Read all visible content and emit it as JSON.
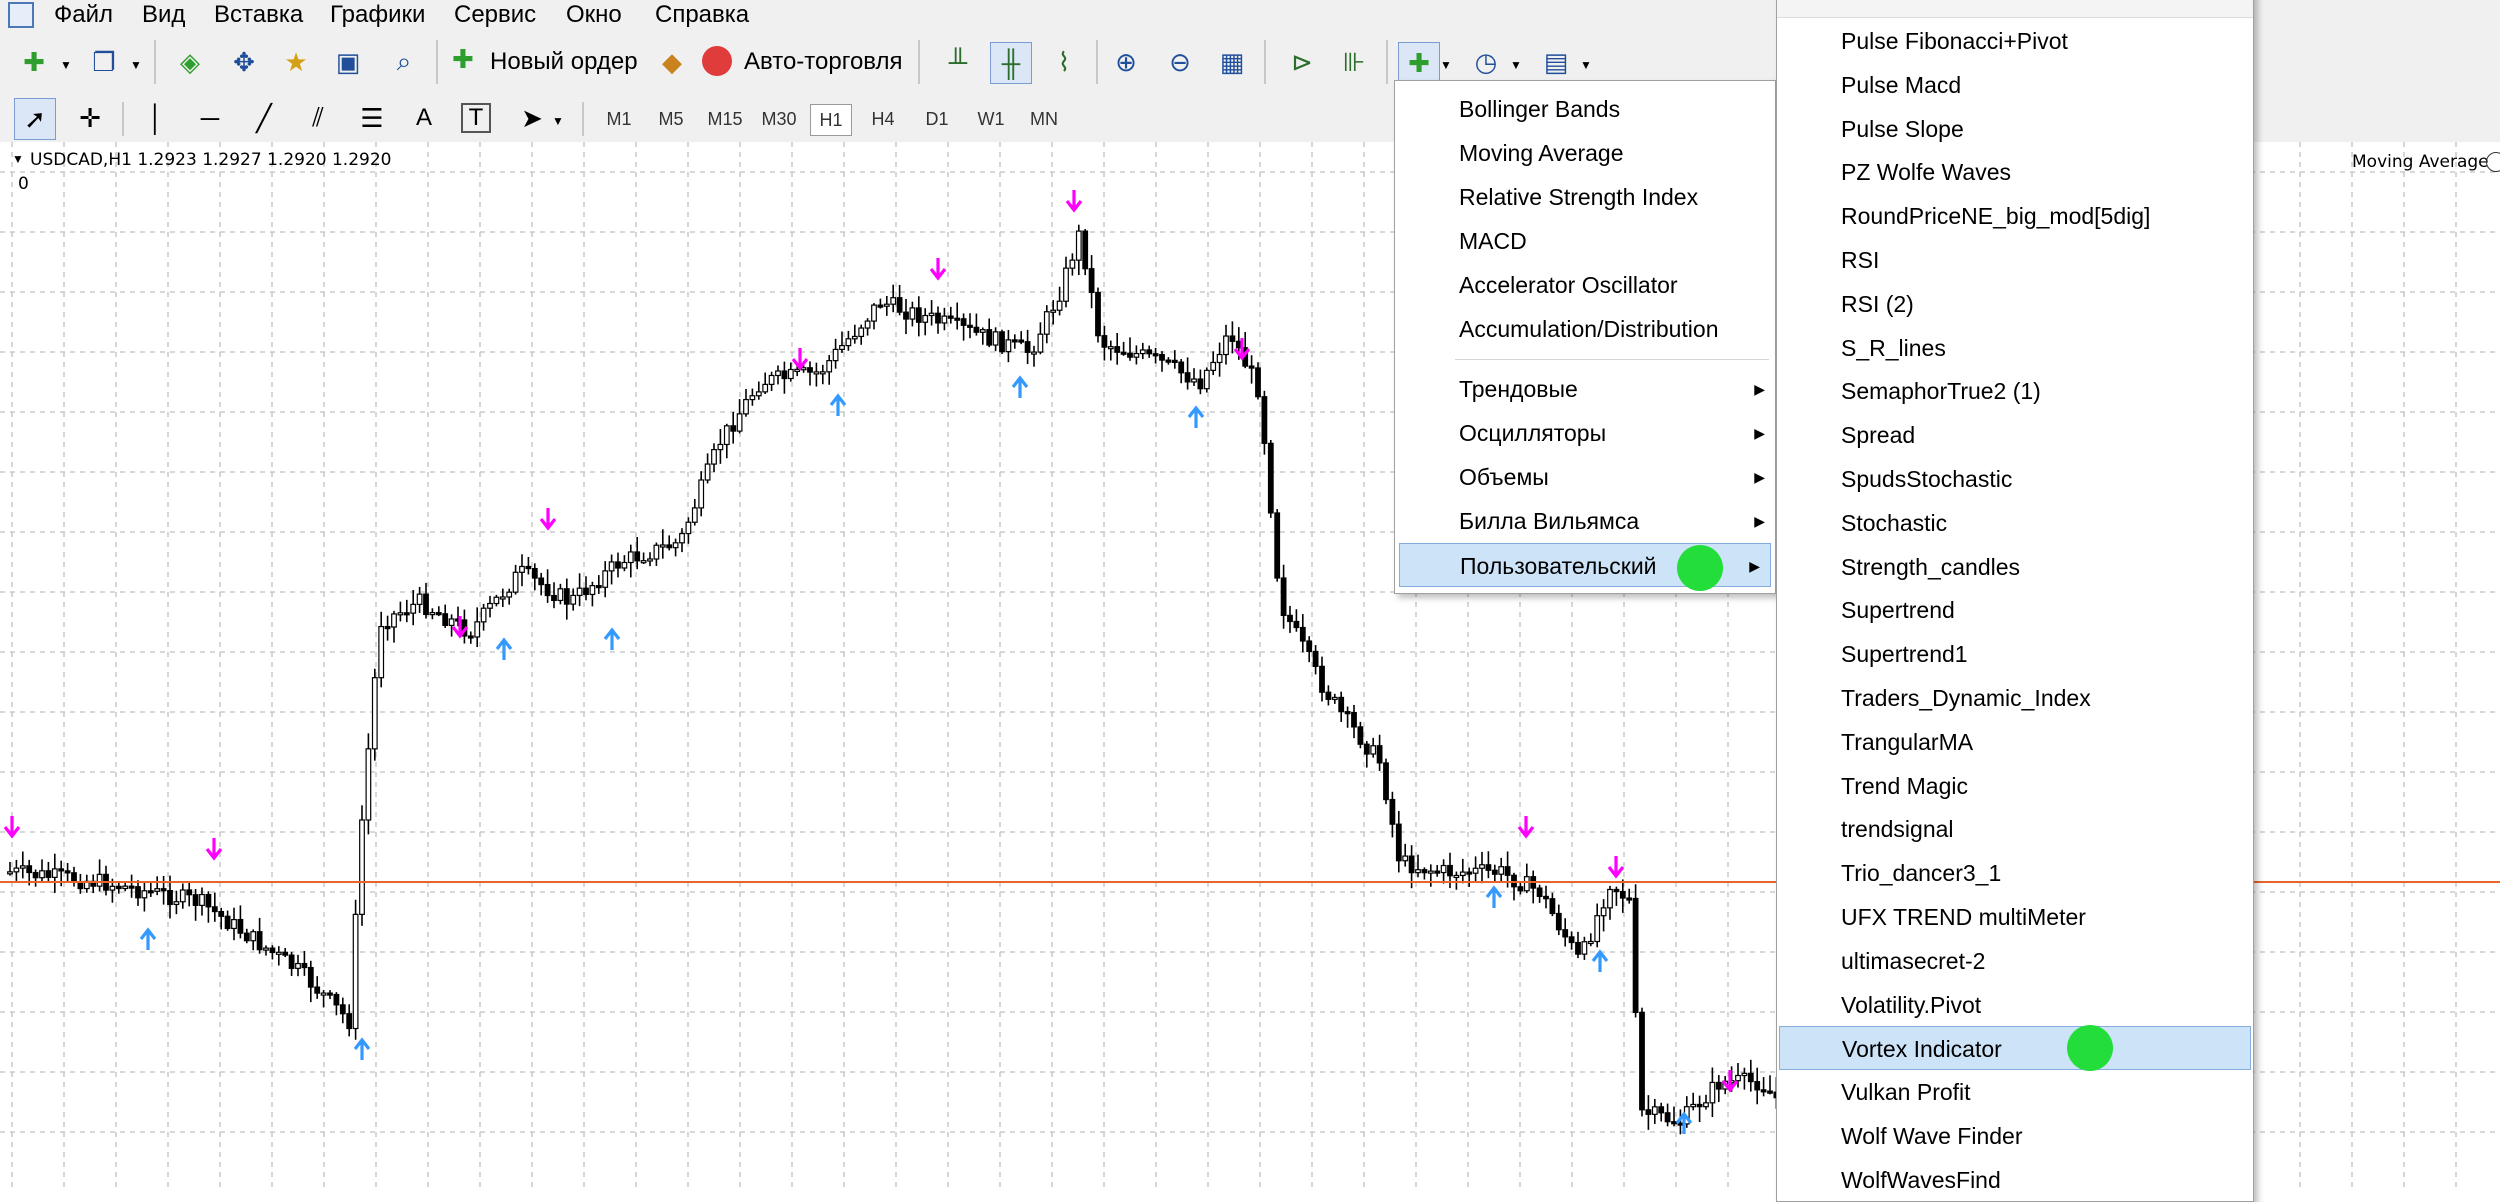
{
  "menubar": {
    "items": [
      "Файл",
      "Вид",
      "Вставка",
      "Графики",
      "Сервис",
      "Окно",
      "Справка"
    ]
  },
  "toolbar": {
    "new_order_label": "Новый ордер",
    "auto_trading_label": "Авто-торговля",
    "timeframes": [
      "M1",
      "M5",
      "M15",
      "M30",
      "H1",
      "H4",
      "D1",
      "W1",
      "MN"
    ],
    "active_timeframe": "H1",
    "text_tool": "A",
    "label_tool": "T"
  },
  "chart": {
    "header": "USDCAD,H1  1.2923 1.2927 1.2920 1.2920",
    "sub_value": "0",
    "indicator_label": "Moving Average",
    "colors": {
      "candles": "#000000",
      "grid": "#c0c0c0",
      "price_line": "#e8642a",
      "up_arrow": "#3399ff",
      "down_arrow": "#ff00ff"
    }
  },
  "indicators_menu": {
    "items": [
      {
        "label": "Bollinger Bands"
      },
      {
        "label": "Moving Average"
      },
      {
        "label": "Relative Strength Index"
      },
      {
        "label": "MACD"
      },
      {
        "label": "Accelerator Oscillator"
      },
      {
        "label": "Accumulation/Distribution"
      }
    ],
    "submenus": [
      {
        "label": "Трендовые"
      },
      {
        "label": "Осцилляторы"
      },
      {
        "label": "Объемы"
      },
      {
        "label": "Билла Вильямса"
      },
      {
        "label": "Пользовательский",
        "highlighted": true
      }
    ]
  },
  "custom_menu": {
    "items": [
      "Pulse Fibonacci+Pivot",
      "Pulse Macd",
      "Pulse Slope",
      "PZ Wolfe Waves",
      "RoundPriceNE_big_mod[5dig]",
      "RSI",
      "RSI (2)",
      "S_R_lines",
      "SemaphorTrue2 (1)",
      "Spread",
      "SpudsStochastic",
      "Stochastic",
      "Strength_candles",
      "Supertrend",
      "Supertrend1",
      "Traders_Dynamic_Index",
      "TrangularMA",
      "Trend Magic",
      "trendsignal",
      "Trio_dancer3_1",
      "UFX TREND multiMeter",
      "ultimasecret-2",
      "Volatility.Pivot",
      "Vortex Indicator",
      "Vulkan Profit",
      "Wolf Wave Finder",
      "WolfWavesFind"
    ],
    "highlighted": "Vortex Indicator"
  }
}
